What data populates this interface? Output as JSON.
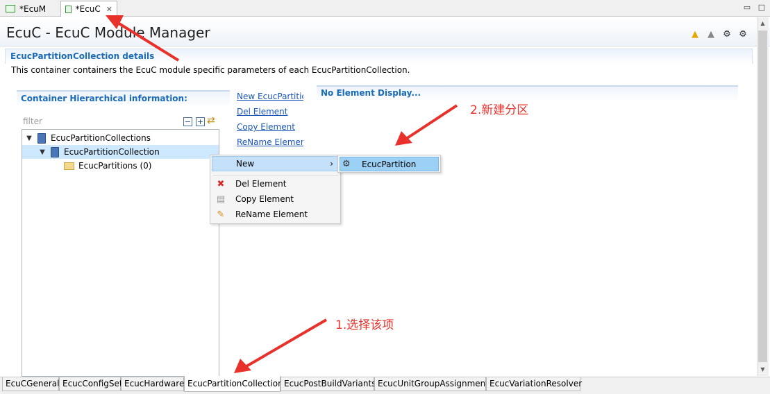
{
  "editor_tabs": [
    {
      "label": "*EcuM",
      "active": false
    },
    {
      "label": "*EcuC",
      "active": true
    }
  ],
  "header": {
    "title": "EcuC - EcuC Module Manager",
    "icons": [
      "warning-yellow-icon",
      "warning-grey-icon",
      "gear-icon",
      "gears-icon"
    ]
  },
  "details": {
    "title": "EcucPartitionCollection details",
    "description": "This container containers the EcuC module specific parameters of each EcucPartitionCollection."
  },
  "hierarchy": {
    "title": "Container Hierarchical information:",
    "filter_placeholder": "filter",
    "tree": [
      {
        "label": "EcucPartitionCollections",
        "expanded": true,
        "selected": false
      },
      {
        "label": "EcucPartitionCollection",
        "expanded": true,
        "selected": true
      },
      {
        "label": "EcucPartitions (0)",
        "expanded": false,
        "selected": false
      }
    ]
  },
  "links": [
    "New EcucPartitic",
    "Del Element",
    "Copy Element",
    "ReName Elemen"
  ],
  "right_panel": {
    "title": "No Element Display..."
  },
  "context_menu": {
    "items": [
      "New",
      "Del Element",
      "Copy Element",
      "ReName Element"
    ],
    "submenu_arrow": "›",
    "submenu": [
      "EcucPartition"
    ]
  },
  "bottom_tabs": [
    {
      "label": "EcuCGeneral",
      "active": false
    },
    {
      "label": "EcucConfigSet",
      "active": false
    },
    {
      "label": "EcucHardware",
      "active": false
    },
    {
      "label": "EcucPartitionCollection",
      "active": true
    },
    {
      "label": "EcucPostBuildVariants",
      "active": false
    },
    {
      "label": "EcucUnitGroupAssignment",
      "active": false
    },
    {
      "label": "EcucVariationResolver",
      "active": false
    }
  ],
  "annotations": {
    "step1": "1.选择该项",
    "step2": "2.新建分区",
    "color": "#e8312b"
  }
}
